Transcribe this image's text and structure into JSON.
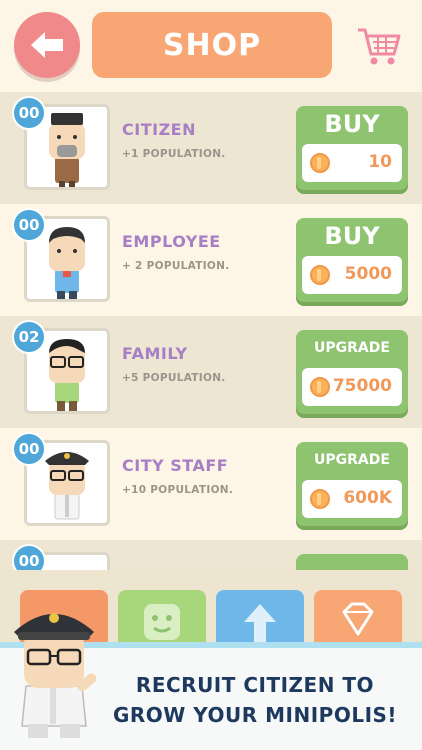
{
  "header": {
    "title": "SHOP"
  },
  "items": [
    {
      "count": "00",
      "name": "CITIZEN",
      "desc": "+1 POPULATION.",
      "action": "BUY",
      "price": "10"
    },
    {
      "count": "00",
      "name": "EMPLOYEE",
      "desc": "+ 2 POPULATION.",
      "action": "BUY",
      "price": "5000"
    },
    {
      "count": "02",
      "name": "FAMILY",
      "desc": "+5 POPULATION.",
      "action": "UPGRADE",
      "price": "75000"
    },
    {
      "count": "00",
      "name": "CITY STAFF",
      "desc": "+10 POPULATION.",
      "action": "UPGRADE",
      "price": "600K"
    },
    {
      "count": "00"
    }
  ],
  "banner": {
    "line1": "RECRUIT CITIZEN TO",
    "line2": "GROW YOUR MINIPOLIS!"
  },
  "colors": {
    "background": "#fdf6e6",
    "accent": "#f9a675",
    "buy_green": "#8ec46f",
    "name_purple": "#a87fc4",
    "badge_blue": "#4fa6d9"
  }
}
